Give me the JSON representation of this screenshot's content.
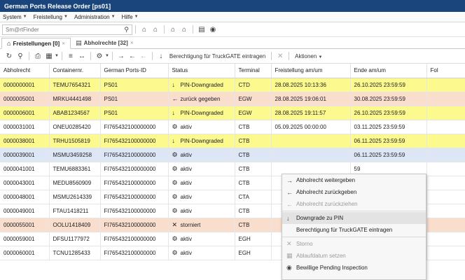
{
  "window": {
    "title": "German Ports Release Order [ps01]"
  },
  "menubar": [
    {
      "label": "System"
    },
    {
      "label": "Freistellung"
    },
    {
      "label": "Administration"
    },
    {
      "label": "Hilfe"
    }
  ],
  "finder": {
    "placeholder": "Sm@rtFinder"
  },
  "tabs": [
    {
      "label": "Freistellungen [0]"
    },
    {
      "label": "Abholrechte [32]"
    }
  ],
  "toolbar2": {
    "berechtigung_label": "Berechtigung für TruckGATE eintragen",
    "aktionen_label": "Aktionen"
  },
  "columns": [
    "Abholrecht",
    "Containernr.",
    "German Ports-ID",
    "Status",
    "Terminal",
    "Freistellung am/um",
    "Ende am/um",
    "Fol"
  ],
  "rows": [
    {
      "abholrecht": "0000000001",
      "container": "TEMU7654321",
      "gpid": "PS01",
      "status_icon": "↓",
      "status": "PIN-Downgraded",
      "terminal": "CTD",
      "freistellung": "28.08.2025 10:13:36",
      "ende": "26.10.2025 23:59:59",
      "color": "yellow"
    },
    {
      "abholrecht": "0000005001",
      "container": "MRKU4441498",
      "gpid": "PS01",
      "status_icon": "←",
      "status": "zurück gegeben",
      "terminal": "EGW",
      "freistellung": "28.08.2025 19:06:01",
      "ende": "30.08.2025 23:59:59",
      "color": "salmon"
    },
    {
      "abholrecht": "0000006001",
      "container": "ABAB1234567",
      "gpid": "PS01",
      "status_icon": "↓",
      "status": "PIN-Downgraded",
      "terminal": "EGW",
      "freistellung": "28.08.2025 19:11:57",
      "ende": "26.10.2025 23:59:59",
      "color": "yellow"
    },
    {
      "abholrecht": "0000031001",
      "container": "ONEU0285420",
      "gpid": "FI765432100000000",
      "status_icon": "⚙",
      "status": "aktiv",
      "terminal": "CTB",
      "freistellung": "05.09.2025 00:00:00",
      "ende": "03.11.2025 23:59:59",
      "color": "white"
    },
    {
      "abholrecht": "0000038001",
      "container": "TRHU1505819",
      "gpid": "FI765432100000000",
      "status_icon": "↓",
      "status": "PIN-Downgraded",
      "terminal": "CTB",
      "freistellung": "",
      "ende": "06.11.2025 23:59:59",
      "color": "yellow"
    },
    {
      "abholrecht": "0000039001",
      "container": "MSMU3459258",
      "gpid": "FI765432100000000",
      "status_icon": "⚙",
      "status": "aktiv",
      "terminal": "CTB",
      "freistellung": "",
      "ende": "06.11.2025 23:59:59",
      "color": "selected"
    },
    {
      "abholrecht": "0000041001",
      "container": "TEMU6883361",
      "gpid": "FI765432100000000",
      "status_icon": "⚙",
      "status": "aktiv",
      "terminal": "CTB",
      "freistellung": "",
      "ende": "59",
      "color": "white"
    },
    {
      "abholrecht": "0000043001",
      "container": "MEDU8560909",
      "gpid": "FI765432100000000",
      "status_icon": "⚙",
      "status": "aktiv",
      "terminal": "CTB",
      "freistellung": "",
      "ende": "59",
      "color": "white"
    },
    {
      "abholrecht": "0000048001",
      "container": "MSMU2614339",
      "gpid": "FI765432100000000",
      "status_icon": "⚙",
      "status": "aktiv",
      "terminal": "CTA",
      "freistellung": "",
      "ende": "59",
      "color": "white"
    },
    {
      "abholrecht": "0000049001",
      "container": "FTAU1418211",
      "gpid": "FI765432100000000",
      "status_icon": "⚙",
      "status": "aktiv",
      "terminal": "CTB",
      "freistellung": "",
      "ende": "59",
      "color": "white"
    },
    {
      "abholrecht": "0000055001",
      "container": "OOLU1418409",
      "gpid": "FI765432100000000",
      "status_icon": "✕",
      "status": "storniert",
      "terminal": "CTB",
      "freistellung": "",
      "ende": "00",
      "color": "salmon"
    },
    {
      "abholrecht": "0000059001",
      "container": "DFSU1177972",
      "gpid": "FI765432100000000",
      "status_icon": "⚙",
      "status": "aktiv",
      "terminal": "EGH",
      "freistellung": "",
      "ende": "00",
      "color": "white"
    },
    {
      "abholrecht": "0000060001",
      "container": "TCNU1285433",
      "gpid": "FI765432100000000",
      "status_icon": "⚙",
      "status": "aktiv",
      "terminal": "EGH",
      "freistellung": "",
      "ende": "59",
      "color": "white"
    }
  ],
  "context_menu": [
    {
      "icon": "→",
      "label": "Abholrecht weitergeben",
      "disabled": false
    },
    {
      "icon": "←",
      "label": "Abholrecht zurückgeben",
      "disabled": false
    },
    {
      "icon": "←",
      "label": "Abholrecht zurückziehen",
      "disabled": true
    },
    {
      "separator": true
    },
    {
      "icon": "↓",
      "label": "Downgrade zu PIN",
      "disabled": false,
      "hover": true
    },
    {
      "icon": "",
      "label": "Berechtigung für TruckGATE eintragen",
      "disabled": false
    },
    {
      "separator": true
    },
    {
      "icon": "✕",
      "label": "Storno",
      "disabled": true
    },
    {
      "icon": "▦",
      "label": "Ablaufdatum setzen",
      "disabled": true
    },
    {
      "icon": "◉",
      "label": "Bewillige Pending Inspection",
      "disabled": false
    }
  ]
}
